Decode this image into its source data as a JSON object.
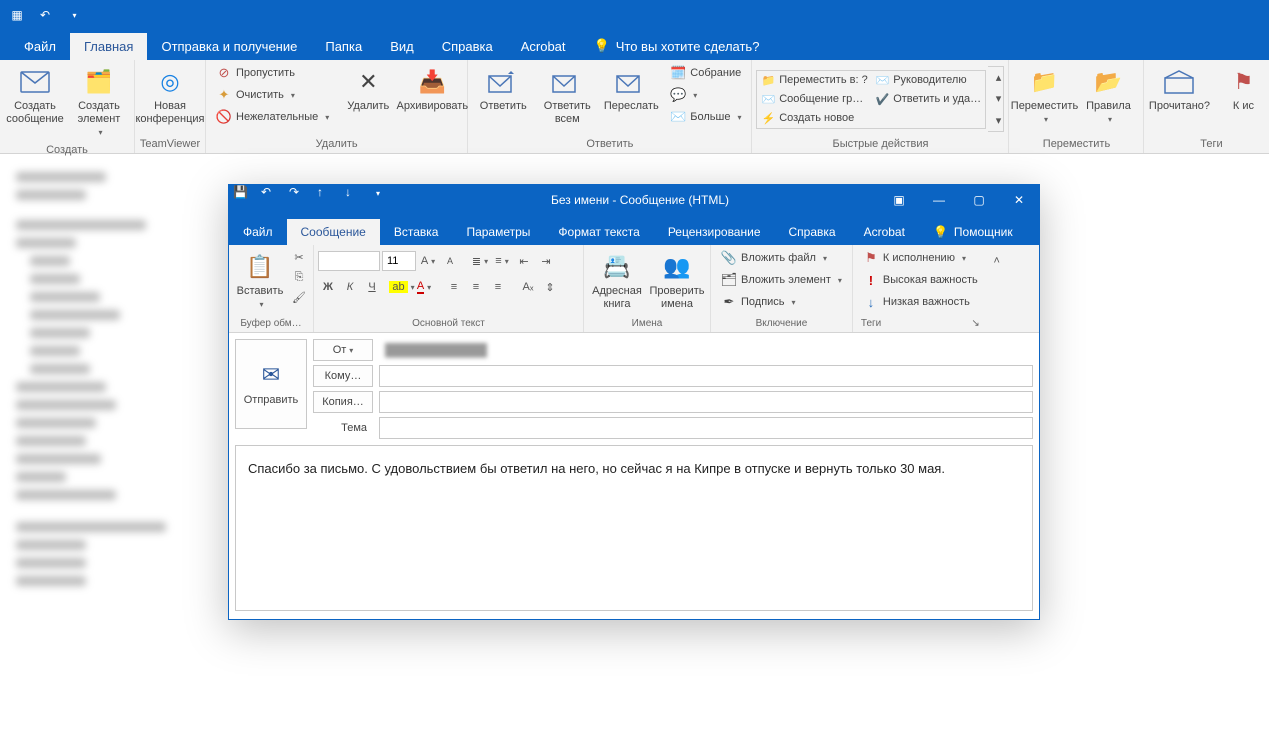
{
  "main": {
    "tabs": [
      "Файл",
      "Главная",
      "Отправка и получение",
      "Папка",
      "Вид",
      "Справка",
      "Acrobat"
    ],
    "active_tab": 1,
    "tell_me": "Что вы хотите сделать?",
    "ribbon": {
      "create": {
        "label": "Создать",
        "new_msg": "Создать сообщение",
        "new_items": "Создать элемент"
      },
      "teamviewer": {
        "label": "TeamViewer",
        "btn": "Новая конференция"
      },
      "delete": {
        "label": "Удалить",
        "ignore": "Пропустить",
        "clean": "Очистить",
        "junk": "Нежелательные",
        "del": "Удалить",
        "archive": "Архивировать"
      },
      "respond": {
        "label": "Ответить",
        "reply": "Ответить",
        "reply_all": "Ответить всем",
        "forward": "Переслать",
        "meeting": "Собрание",
        "im": "",
        "more": "Больше"
      },
      "quick": {
        "label": "Быстрые действия",
        "items": [
          "Переместить в: ?",
          "Руководителю",
          "Сообщение гр…",
          "Ответить и уда…",
          "Создать новое",
          ""
        ]
      },
      "move": {
        "label": "Переместить",
        "move": "Переместить",
        "rules": "Правила"
      },
      "tags": {
        "label": "Теги",
        "read": "Прочитано?",
        "cat": "К ис"
      }
    }
  },
  "compose": {
    "title": "Без имени  -  Сообщение (HTML)",
    "tabs": [
      "Файл",
      "Сообщение",
      "Вставка",
      "Параметры",
      "Формат текста",
      "Рецензирование",
      "Справка",
      "Acrobat"
    ],
    "active_tab": 1,
    "helper": "Помощник",
    "ribbon": {
      "clipboard": {
        "label": "Буфер обм…",
        "paste": "Вставить"
      },
      "font": {
        "label": "Основной текст",
        "size": "11",
        "bold": "Ж",
        "italic": "К",
        "underline": "Ч"
      },
      "names": {
        "label": "Имена",
        "book": "Адресная книга",
        "check": "Проверить имена"
      },
      "include": {
        "label": "Включение",
        "attach_file": "Вложить файл",
        "attach_item": "Вложить элемент",
        "signature": "Подпись"
      },
      "tags": {
        "label": "Теги",
        "follow": "К исполнению",
        "high": "Высокая важность",
        "low": "Низкая важность"
      }
    },
    "send": "Отправить",
    "from_label": "От",
    "to_label": "Кому…",
    "cc_label": "Копия…",
    "subject_label": "Тема",
    "body": "Спасибо за письмо. С удовольствием бы ответил на него, но сейчас я на Кипре в отпуске и вернуть только 30 мая."
  }
}
